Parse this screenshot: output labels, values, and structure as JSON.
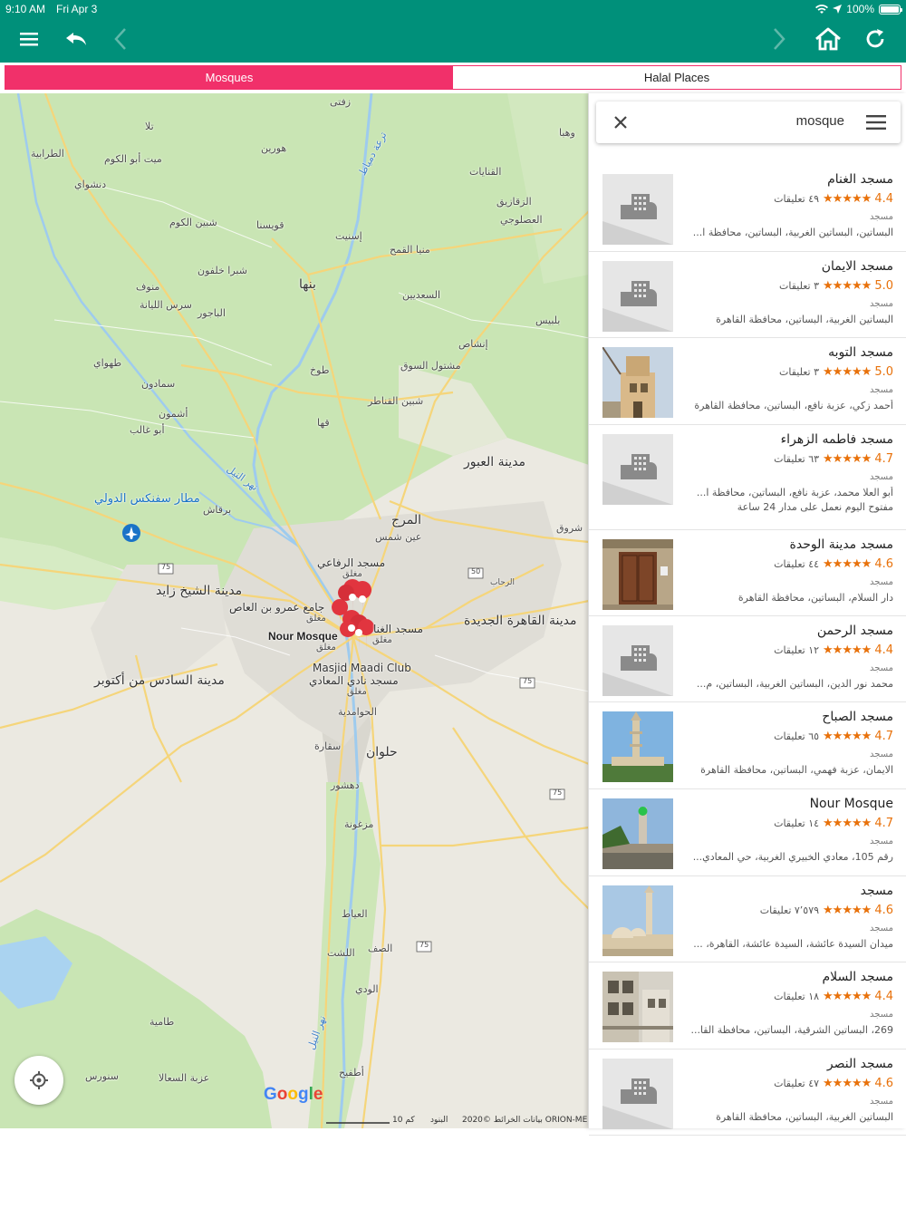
{
  "status_bar": {
    "time": "9:10 AM",
    "date": "Fri Apr 3",
    "battery": "100%"
  },
  "toolbar": {
    "icons": [
      "menu-icon",
      "undo-icon",
      "back-icon",
      "forward-icon",
      "home-icon",
      "refresh-icon"
    ]
  },
  "tabs": {
    "mosques": "Mosques",
    "halal": "Halal Places"
  },
  "colors": {
    "brand": "#00907a",
    "accent": "#f1306a",
    "rating": "#e8710a"
  },
  "search": {
    "value": "mosque"
  },
  "map": {
    "labels": {
      "zefta": "زفتى",
      "tala": "تلا",
      "hawarin": "هورين",
      "tarabiya": "الطرابية",
      "mit_abu_kom": "ميت أبو الكوم",
      "dinshway": "دنشواي",
      "shebin": "شبين الكوم",
      "quesna": "قويسنا",
      "benha": "بنها",
      "menouf": "منوف",
      "shubra_khalfoun": "شبرا خلفون",
      "sirs_layan": "سرس الليانة",
      "bajour": "الباجور",
      "tahway": "طهواي",
      "samadoun": "سمادون",
      "ashmoun": "أشمون",
      "abu_ghaleb": "أبو غالب",
      "tukh": "طوخ",
      "shibin_qanater": "شبين القناطر",
      "qaha": "قها",
      "qanayat": "القنايات",
      "zagazig": "الزقازيق",
      "aslougy": "العصلوجي",
      "minya_qamh": "منيا القمح",
      "saadin": "السعديين",
      "belbeis": "بلبيس",
      "inshas": "إنشاص",
      "mashtool": "مشتول السوق",
      "atmida": "إسنيت",
      "ubour": "مدينة العبور",
      "marg": "المرج",
      "ain_shams": "عين شمس",
      "shorouk": "شروق",
      "rifai_mosque": "مسجد الرفاعي",
      "amr_mosque": "جامع عمرو بن العاص",
      "nour_mosque": "Nour Mosque",
      "ghannam_mosque": "مسجد الغنا",
      "maadi_club": "Masjid Maadi Club",
      "maadi_club_ar": "مسجد نادي المعادي",
      "closed": "مغلق",
      "new_cairo": "مدينة القاهرة الجديدة",
      "rehab": "الرحاب",
      "zayed": "مدينة الشيخ زايد",
      "october": "مدينة السادس من أكتوبر",
      "sphinx_airport": "مطار سفنكس الدولي",
      "bargash": "برقاش",
      "hawamdeya": "الحوامدية",
      "saqqara": "سقارة",
      "helwan": "حلوان",
      "dahshour": "دهشور",
      "mazghouna": "مزغونة",
      "ayyat": "العياط",
      "saff": "الصف",
      "lisht": "اللشت",
      "wadi": "الودي",
      "atfih": "أطفيح",
      "tamiya": "طامية",
      "senoures": "سنورس",
      "azbet_ahmed": "عزبة السعالا",
      "nile": "نهر النيل",
      "canal": "ترعة دمياط",
      "wahy": "وهبا",
      "hwy_75": "75",
      "hwy_50": "50"
    },
    "scale": "10 كم",
    "attribution": "بيانات الخرائط ©2020 ORION-ME",
    "terms": "البنود",
    "google": [
      "G",
      "o",
      "o",
      "g",
      "l",
      "e"
    ]
  },
  "results": [
    {
      "name": "مسجد الغنام",
      "rating": "4.4",
      "stars": "★★★★★",
      "reviews": "٤٩ تعليقات",
      "type": "مسجد",
      "address": "البساتين، البساتين الغربية، البساتين، محافظة ا...",
      "thumb": "placeholder"
    },
    {
      "name": "مسجد الايمان",
      "rating": "5.0",
      "stars": "★★★★★",
      "reviews": "٣ تعليقات",
      "type": "مسجد",
      "address": "البساتين الغربية، البساتين، محافظة القاهرة",
      "thumb": "placeholder"
    },
    {
      "name": "مسجد التوبه",
      "rating": "5.0",
      "stars": "★★★★★",
      "reviews": "٣ تعليقات",
      "type": "مسجد",
      "address": "أحمد زكي، عزبة نافع، البساتين، محافظة القاهرة",
      "thumb": "photo-building"
    },
    {
      "name": "مسجد فاطمه الزهراء",
      "rating": "4.7",
      "stars": "★★★★★",
      "reviews": "٦٣ تعليقات",
      "type": "مسجد",
      "address": "أبو العلا محمد، عزبة نافع، البساتين، محافظة ا...",
      "extra": "مفتوح اليوم نعمل على مدار 24 ساعة",
      "thumb": "placeholder"
    },
    {
      "name": "مسجد مدينة الوحدة",
      "rating": "4.6",
      "stars": "★★★★★",
      "reviews": "٤٤ تعليقات",
      "type": "مسجد",
      "address": "دار السلام، البساتين، محافظة القاهرة",
      "thumb": "photo-door"
    },
    {
      "name": "مسجد الرحمن",
      "rating": "4.4",
      "stars": "★★★★★",
      "reviews": "١٢ تعليقات",
      "type": "مسجد",
      "address": "محمد نور الدين، البساتين الغربية، البساتين، م...",
      "thumb": "placeholder"
    },
    {
      "name": "مسجد الصباح",
      "rating": "4.7",
      "stars": "★★★★★",
      "reviews": "٦٥ تعليقات",
      "type": "مسجد",
      "address": "الايمان، عزبة فهمي، البساتين، محافظة القاهرة",
      "thumb": "photo-minaret"
    },
    {
      "name": "Nour Mosque",
      "rating": "4.7",
      "stars": "★★★★★",
      "reviews": "١٤ تعليقات",
      "type": "مسجد",
      "address": "رقم 105، معادي الخبيري الغربية، حي المعادي...",
      "thumb": "photo-green"
    },
    {
      "name": "مسجد",
      "rating": "4.6",
      "stars": "★★★★★",
      "reviews": "٧٬٥٧٩ تعليقات",
      "type": "مسجد",
      "address": "ميدان السيدة عائشة، السيدة عائشة، القاهرة، ...",
      "thumb": "photo-domes"
    },
    {
      "name": "مسجد السلام",
      "rating": "4.4",
      "stars": "★★★★★",
      "reviews": "١٨ تعليقات",
      "type": "مسجد",
      "address": "269، البساتين الشرقية، البساتين، محافظة القا...",
      "thumb": "photo-apartments"
    },
    {
      "name": "مسجد النصر",
      "rating": "4.6",
      "stars": "★★★★★",
      "reviews": "٤٧ تعليقات",
      "type": "مسجد",
      "address": "البساتين الغربية، البساتين، محافظة القاهرة",
      "thumb": "placeholder"
    }
  ]
}
